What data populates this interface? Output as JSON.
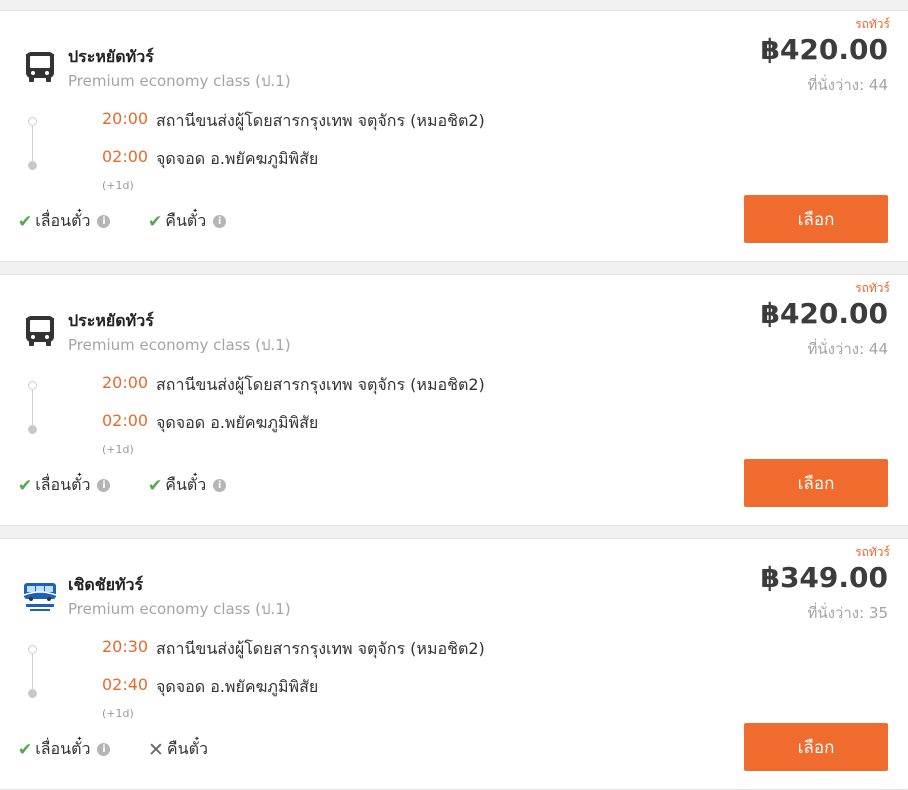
{
  "cards": [
    {
      "tag": "รถทัวร์",
      "logo": "bus-icon",
      "operator": "ประหยัดทัวร์",
      "class": "Premium economy class (ป.1)",
      "price": "฿420.00",
      "seats": "ที่นั่งว่าง: 44",
      "depart_time": "20:00",
      "depart_place": "สถานีขนส่งผู้โดยสารกรุงเทพ จตุจักร (หมอชิต2)",
      "arrive_time": "02:00",
      "arrive_place": "จุดจอด อ.พยัคฆภูมิพิสัย",
      "next_day": "(+1d)",
      "feature1": {
        "label": "เลื่อนตั๋ว",
        "available": true
      },
      "feature2": {
        "label": "คืนตั๋ว",
        "available": true
      },
      "button": "เลือก"
    },
    {
      "tag": "รถทัวร์",
      "logo": "bus-icon",
      "operator": "ประหยัดทัวร์",
      "class": "Premium economy class (ป.1)",
      "price": "฿420.00",
      "seats": "ที่นั่งว่าง: 44",
      "depart_time": "20:00",
      "depart_place": "สถานีขนส่งผู้โดยสารกรุงเทพ จตุจักร (หมอชิต2)",
      "arrive_time": "02:00",
      "arrive_place": "จุดจอด อ.พยัคฆภูมิพิสัย",
      "next_day": "(+1d)",
      "feature1": {
        "label": "เลื่อนตั๋ว",
        "available": true
      },
      "feature2": {
        "label": "คืนตั๋ว",
        "available": true
      },
      "button": "เลือก"
    },
    {
      "tag": "รถทัวร์",
      "logo": "chercharn-tour-logo",
      "operator": "เชิดชัยทัวร์",
      "class": "Premium economy class (ป.1)",
      "price": "฿349.00",
      "seats": "ที่นั่งว่าง: 35",
      "depart_time": "20:30",
      "depart_place": "สถานีขนส่งผู้โดยสารกรุงเทพ จตุจักร (หมอชิต2)",
      "arrive_time": "02:40",
      "arrive_place": "จุดจอด อ.พยัคฆภูมิพิสัย",
      "next_day": "(+1d)",
      "feature1": {
        "label": "เลื่อนตั๋ว",
        "available": true
      },
      "feature2": {
        "label": "คืนตั๋ว",
        "available": false
      },
      "button": "เลือก"
    }
  ],
  "icons": {
    "check": "✔",
    "cross": "✕",
    "info": "i"
  },
  "colors": {
    "accent": "#ef6b2e",
    "time": "#e8692c",
    "ok": "#53a84b"
  }
}
